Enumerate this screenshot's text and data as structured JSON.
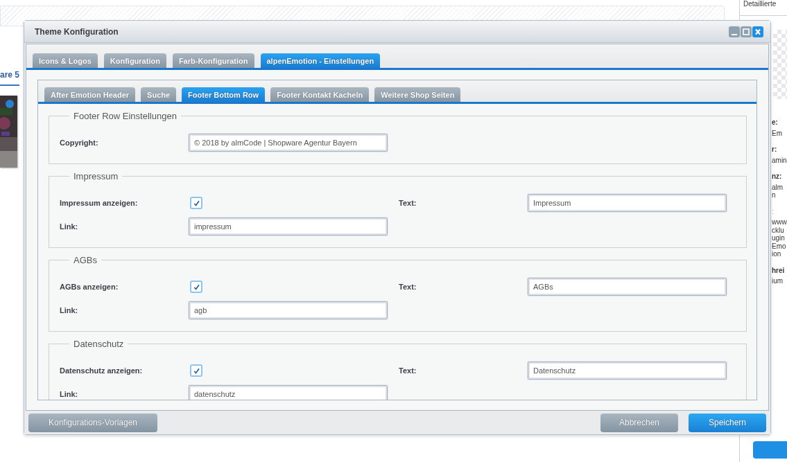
{
  "background": {
    "side_tab": "are 5",
    "panel_title": "Detaillierte",
    "panel_lines": [
      {
        "kind": "label",
        "text": "e:"
      },
      {
        "kind": "value",
        "text": "Em"
      },
      {
        "kind": "label",
        "text": "r:"
      },
      {
        "kind": "value",
        "text": "amin"
      },
      {
        "kind": "label",
        "text": "nz:"
      },
      {
        "kind": "value",
        "text": "alm"
      },
      {
        "kind": "value",
        "text": "n"
      },
      {
        "kind": "link",
        "text": ":"
      },
      {
        "kind": "value",
        "text": "www"
      },
      {
        "kind": "value",
        "text": "cklu"
      },
      {
        "kind": "value",
        "text": "ugin"
      },
      {
        "kind": "value",
        "text": "Emo"
      },
      {
        "kind": "value",
        "text": "ion"
      },
      {
        "kind": "label",
        "text": "hrei"
      },
      {
        "kind": "value",
        "text": "ium"
      }
    ]
  },
  "window": {
    "title": "Theme Konfiguration"
  },
  "tabs": [
    {
      "label": "Icons & Logos",
      "selected": false
    },
    {
      "label": "Konfiguration",
      "selected": false
    },
    {
      "label": "Farb-Konfiguration",
      "selected": false
    },
    {
      "label": "alpenEmotion - Einstellungen",
      "selected": true
    }
  ],
  "subtabs": [
    {
      "label": "After Emotion Header",
      "selected": false
    },
    {
      "label": "Suche",
      "selected": false
    },
    {
      "label": "Footer Bottom Row",
      "selected": true
    },
    {
      "label": "Footer Kontakt Kacheln",
      "selected": false
    },
    {
      "label": "Weitere Shop Seiten",
      "selected": false
    }
  ],
  "sections": [
    {
      "kind": "single",
      "legend": "Footer Row Einstellungen",
      "field": {
        "label": "Copyright:",
        "value": "© 2018 by almCode | Shopware Agentur Bayern"
      }
    },
    {
      "kind": "toggle",
      "legend": "Impressum",
      "show": {
        "label": "Impressum anzeigen:",
        "checked": true
      },
      "text": {
        "label": "Text:",
        "value": "Impressum"
      },
      "link": {
        "label": "Link:",
        "value": "impressum"
      }
    },
    {
      "kind": "toggle",
      "legend": "AGBs",
      "show": {
        "label": "AGBs anzeigen:",
        "checked": true
      },
      "text": {
        "label": "Text:",
        "value": "AGBs"
      },
      "link": {
        "label": "Link:",
        "value": "agb"
      }
    },
    {
      "kind": "toggle",
      "legend": "Datenschutz",
      "show": {
        "label": "Datenschutz anzeigen:",
        "checked": true
      },
      "text": {
        "label": "Text:",
        "value": "Datenschutz"
      },
      "link": {
        "label": "Link:",
        "value": "datenschutz"
      }
    }
  ],
  "footer": {
    "left_button": "Konfigurations-Vorlagen",
    "cancel_button": "Abbrechen",
    "save_button": "Speichern"
  }
}
